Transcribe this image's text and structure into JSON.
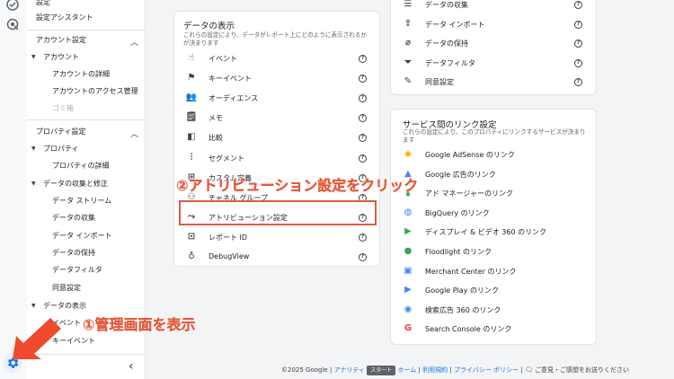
{
  "sidebar": {
    "top_items": [
      "設定",
      "設定アシスタント"
    ],
    "account_section": {
      "title": "アカウント設定",
      "group": "アカウント",
      "items": [
        "アカウントの詳細",
        "アカウントのアクセス管理",
        "ゴミ箱"
      ]
    },
    "property_section": {
      "title": "プロパティ設定",
      "group_property": "プロパティ",
      "property_items": [
        "プロパティの詳細"
      ],
      "group_data": "データの収集と修正",
      "data_items": [
        "データ ストリーム",
        "データの収集",
        "データ インポート",
        "データの保持",
        "データフィルタ",
        "同意設定"
      ],
      "group_display": "データの表示",
      "display_items": [
        "イベント",
        "キーイベント"
      ]
    },
    "collapse_glyph": "‹"
  },
  "display_card": {
    "title": "データの表示",
    "description": "これらの設定により、データがレポート上にどのように表示されるかが決まります",
    "rows": [
      {
        "label": "イベント",
        "icon": "touch-icon"
      },
      {
        "label": "キーイベント",
        "icon": "flag-icon"
      },
      {
        "label": "オーディエンス",
        "icon": "audience-icon"
      },
      {
        "label": "メモ",
        "icon": "note-icon"
      },
      {
        "label": "比較",
        "icon": "compare-icon"
      },
      {
        "label": "セグメント",
        "icon": "segment-icon"
      },
      {
        "label": "カスタム定義",
        "icon": "custom-definition-icon"
      },
      {
        "label": "チャネル グループ",
        "icon": "channel-group-icon"
      },
      {
        "label": "アトリビューション設定",
        "icon": "attribution-icon"
      },
      {
        "label": "レポート ID",
        "icon": "report-id-icon"
      },
      {
        "label": "DebugView",
        "icon": "debug-icon"
      }
    ]
  },
  "collection_card": {
    "rows": [
      {
        "label": "データの収集",
        "icon": "database-icon"
      },
      {
        "label": "データ インポート",
        "icon": "upload-icon"
      },
      {
        "label": "データの保持",
        "icon": "retention-icon"
      },
      {
        "label": "データフィルタ",
        "icon": "filter-icon"
      },
      {
        "label": "同意設定",
        "icon": "consent-icon"
      }
    ]
  },
  "links_card": {
    "title": "サービス間のリンク設定",
    "description": "これらの設定により、このプロパティにリンクするサービスが決まります",
    "rows": [
      {
        "label": "Google AdSense のリンク",
        "icon": "adsense-icon"
      },
      {
        "label": "Google 広告のリンク",
        "icon": "google-ads-icon"
      },
      {
        "label": "アド マネージャーのリンク",
        "icon": "ad-manager-icon"
      },
      {
        "label": "BigQuery のリンク",
        "icon": "bigquery-icon"
      },
      {
        "label": "ディスプレイ & ビデオ 360 のリンク",
        "icon": "dv360-icon"
      },
      {
        "label": "Floodlight のリンク",
        "icon": "floodlight-icon"
      },
      {
        "label": "Merchant Center のリンク",
        "icon": "merchant-center-icon"
      },
      {
        "label": "Google Play のリンク",
        "icon": "google-play-icon"
      },
      {
        "label": "検索広告 360 のリンク",
        "icon": "sa360-icon"
      },
      {
        "label": "Search Console のリンク",
        "icon": "search-console-icon"
      }
    ]
  },
  "annotations": {
    "step1": "①管理画面を表示",
    "step2": "②アトリビューション設定をクリック"
  },
  "footer": {
    "copyright": "©2025 Google",
    "sep": "|",
    "analytics_link": "アナリティ",
    "home_link": "ホーム",
    "terms_link": "利用規約",
    "privacy_link": "プライバシー ポリシー",
    "feedback": "ご意見・ご感想をお送りください",
    "tooltip": "スタート"
  },
  "colors": {
    "accent_red": "#e25a41",
    "link_blue": "#1a73e8",
    "gear_blue": "#1a73e8"
  }
}
